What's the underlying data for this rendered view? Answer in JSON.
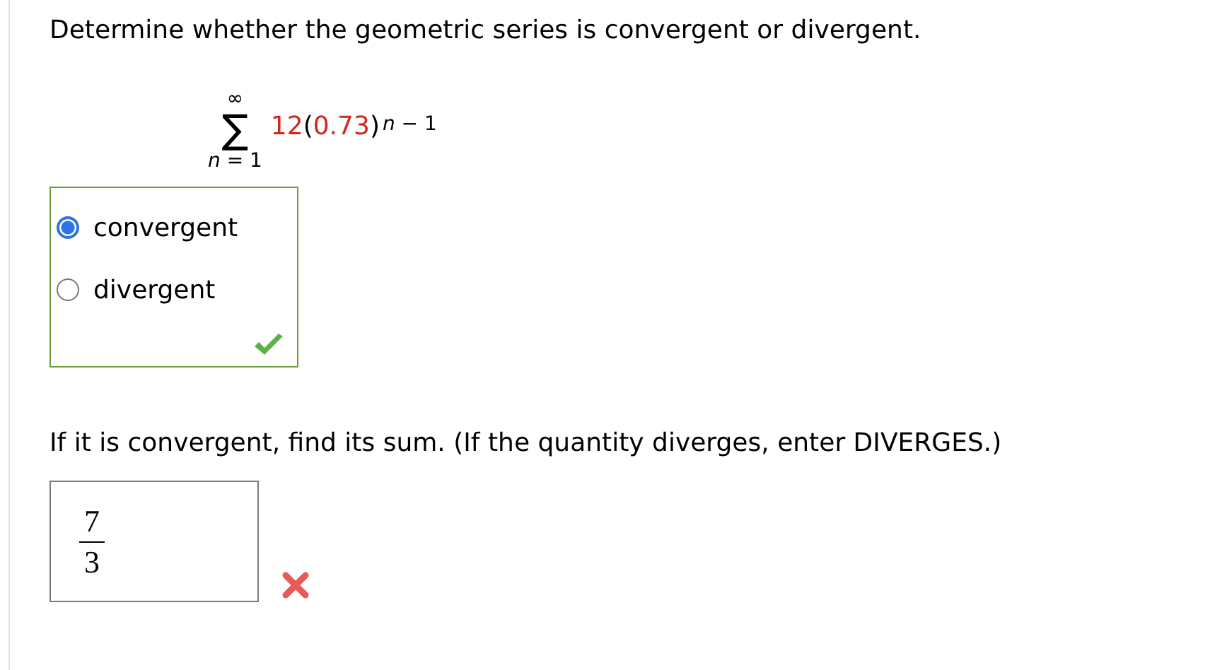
{
  "question": "Determine whether the geometric series is convergent or divergent.",
  "series": {
    "upper": "∞",
    "symbol": "∑",
    "lower": "*n* = 1",
    "term": [
      {
        "text": "12",
        "color": "#d0281c"
      },
      {
        "text": "(",
        "color": "#000000"
      },
      {
        "text": "0.73",
        "color": "#d0281c"
      },
      {
        "text": ")",
        "color": "#000000"
      }
    ],
    "exponent": "*n* − 1"
  },
  "choices": [
    {
      "label": "convergent",
      "selected": true
    },
    {
      "label": "divergent",
      "selected": false
    }
  ],
  "choice_correct": true,
  "prompt": "If it is convergent, find its sum. (If the quantity diverges, enter DIVERGES.)",
  "answer": {
    "numerator": "7",
    "denominator": "3",
    "correct": false
  }
}
